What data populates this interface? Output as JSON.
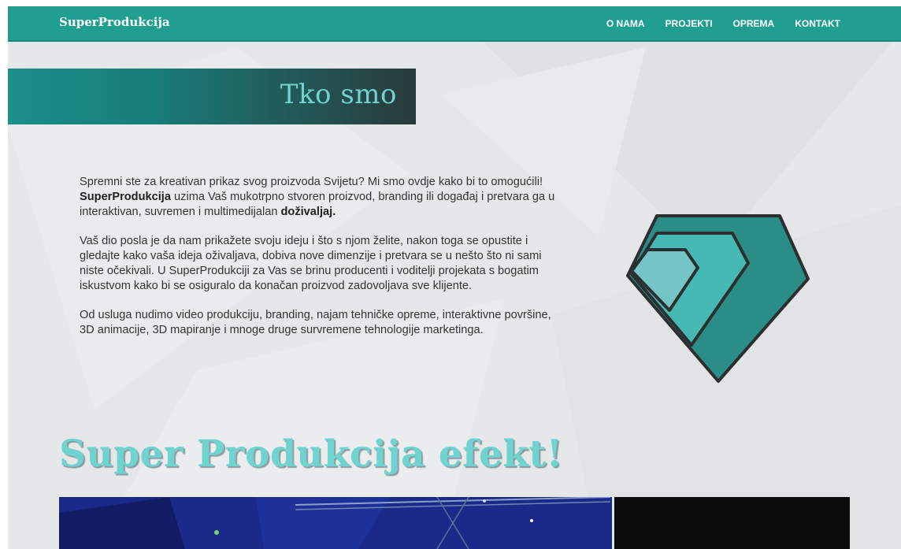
{
  "brand": "SuperProdukcija",
  "nav": [
    {
      "label": "O NAMA"
    },
    {
      "label": "PROJEKTI"
    },
    {
      "label": "OPREMA"
    },
    {
      "label": "KONTAKT"
    }
  ],
  "about": {
    "title": "Tko smo",
    "p1": {
      "a": "Spremni ste za kreativan prikaz svog proizvoda Svijetu? Mi smo ovdje kako bi to omogućili! ",
      "b1": "SuperProdukcija",
      "c": " uzima Vaš mukotrpno stvoren proizvod, branding ili događaj i pretvara ga u interaktivan, suvremen i multimedijalan ",
      "b2": "doživaljaj."
    },
    "p2": "Vaš dio posla je da nam prikažete svoju ideju i što s njom želite, nakon toga se opustite i gledajte kako vaša ideja oživaljava, dobiva nove dimenzije i pretvara se u nešto što ni sami niste očekivali. U SuperProdukciji za Vas se brinu producenti i voditelji projekata s bogatim iskustvom kako bi se osiguralo da konačan proizvod zadovoljava sve klijente.",
    "p3": "Od usluga nudimo video produkciju, branding, najam tehničke opreme, interaktivne površine, 3D animacije, 3D mapiranje i mnoge druge survremene tehnologije marketinga."
  },
  "effect_title": "Super Produkcija efekt!",
  "colors": {
    "nav_bg": "#1f9e91",
    "accent": "#6fd3cf",
    "logo_dark": "#2a8e87",
    "logo_mid": "#47b9b3",
    "logo_light": "#74c6c6",
    "outline": "#2b2f31"
  },
  "icons": {
    "logo": "diamond-logo-icon"
  }
}
